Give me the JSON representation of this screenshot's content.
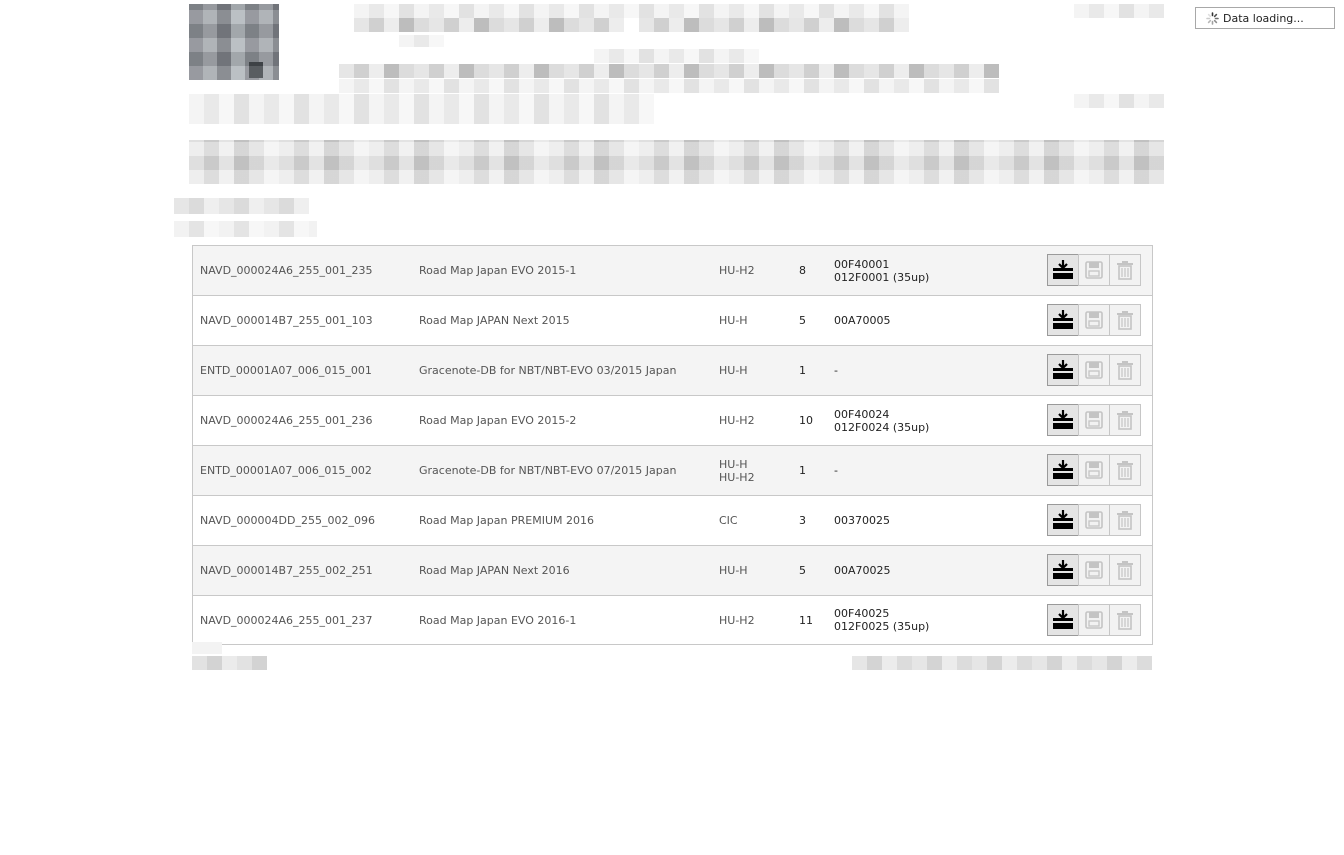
{
  "loading": {
    "label": "Data loading..."
  },
  "table": {
    "rows": [
      {
        "id": "NAVD_000024A6_255_001_235",
        "name": "Road Map Japan EVO 2015-1",
        "hu": [
          "HU-H2"
        ],
        "count": "8",
        "codes": [
          "00F40001",
          "012F0001 (35up)"
        ]
      },
      {
        "id": "NAVD_000014B7_255_001_103",
        "name": "Road Map JAPAN Next 2015",
        "hu": [
          "HU-H"
        ],
        "count": "5",
        "codes": [
          "00A70005"
        ]
      },
      {
        "id": "ENTD_00001A07_006_015_001",
        "name": "Gracenote-DB for NBT/NBT-EVO 03/2015 Japan",
        "hu": [
          "HU-H"
        ],
        "count": "1",
        "codes": [
          "-"
        ]
      },
      {
        "id": "NAVD_000024A6_255_001_236",
        "name": "Road Map Japan EVO 2015-2",
        "hu": [
          "HU-H2"
        ],
        "count": "10",
        "codes": [
          "00F40024",
          "012F0024 (35up)"
        ]
      },
      {
        "id": "ENTD_00001A07_006_015_002",
        "name": "Gracenote-DB for NBT/NBT-EVO 07/2015 Japan",
        "hu": [
          "HU-H",
          "HU-H2"
        ],
        "count": "1",
        "codes": [
          "-"
        ]
      },
      {
        "id": "NAVD_000004DD_255_002_096",
        "name": "Road Map Japan PREMIUM 2016",
        "hu": [
          "CIC"
        ],
        "count": "3",
        "codes": [
          "00370025"
        ]
      },
      {
        "id": "NAVD_000014B7_255_002_251",
        "name": "Road Map JAPAN Next 2016",
        "hu": [
          "HU-H"
        ],
        "count": "5",
        "codes": [
          "00A70025"
        ]
      },
      {
        "id": "NAVD_000024A6_255_001_237",
        "name": "Road Map Japan EVO 2016-1",
        "hu": [
          "HU-H2"
        ],
        "count": "11",
        "codes": [
          "00F40025",
          "012F0025 (35up)"
        ]
      }
    ],
    "actions": [
      "download-icon",
      "save-icon",
      "trash-icon"
    ]
  }
}
